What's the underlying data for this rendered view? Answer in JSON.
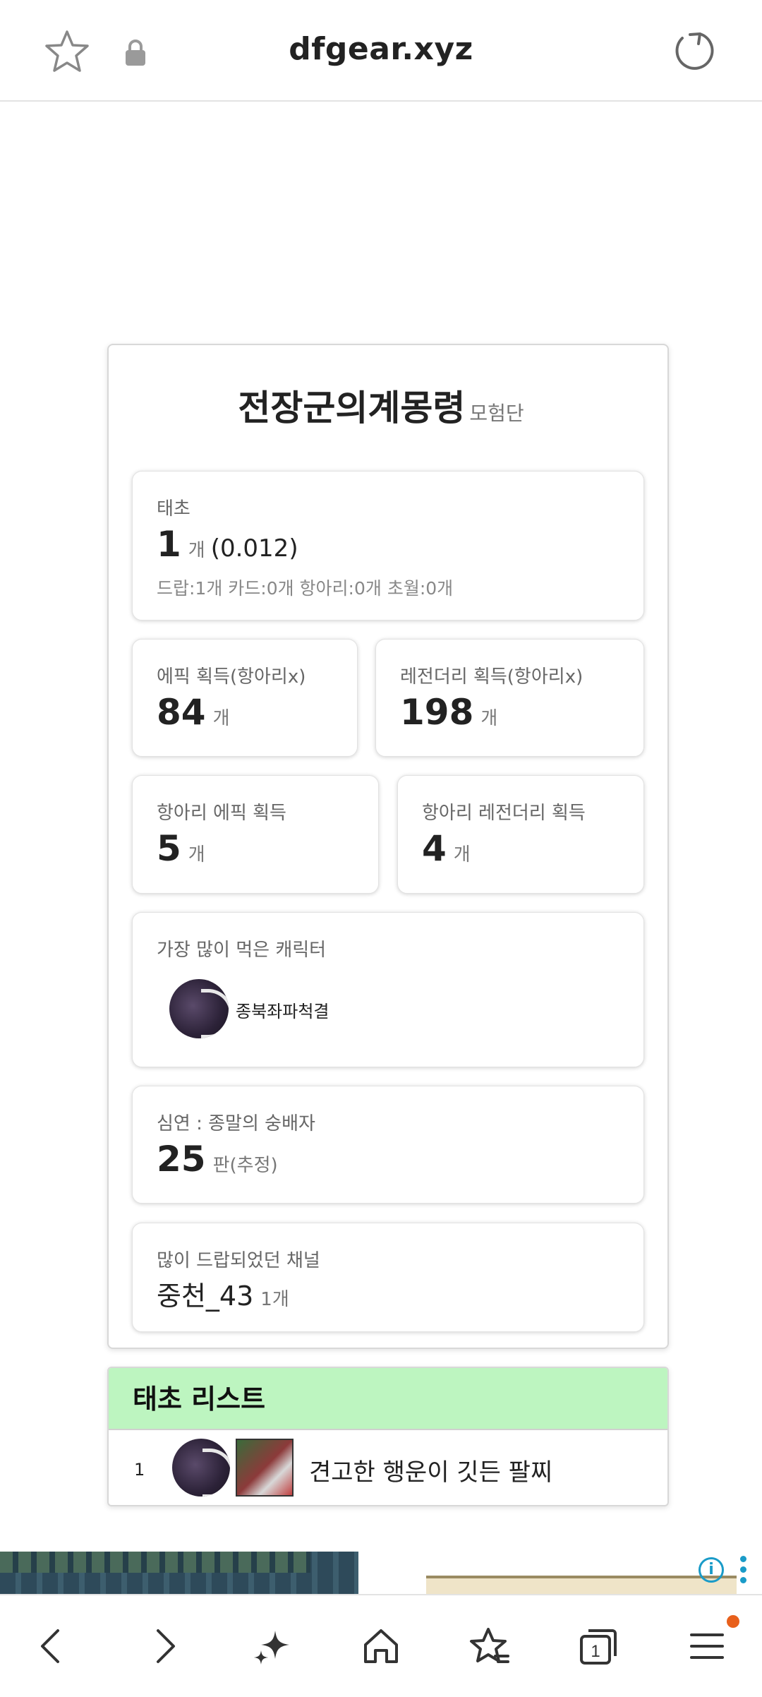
{
  "browser": {
    "url": "dfgear.xyz",
    "tab_count": "1"
  },
  "card": {
    "title": "전장군의계몽령",
    "subtitle": "모험단"
  },
  "taecho": {
    "label": "태초",
    "value": "1",
    "unit": "개",
    "ratio": "(0.012)",
    "detail": "드랍:1개 카드:0개 항아리:0개 초월:0개"
  },
  "epic": {
    "label": "에픽 획득(항아리x)",
    "value": "84",
    "unit": "개"
  },
  "legendary": {
    "label": "레전더리 획득(항아리x)",
    "value": "198",
    "unit": "개"
  },
  "pot_epic": {
    "label": "항아리 에픽 획득",
    "value": "5",
    "unit": "개"
  },
  "pot_legendary": {
    "label": "항아리 레전더리 획득",
    "value": "4",
    "unit": "개"
  },
  "top_character": {
    "label": "가장 많이 먹은 캐릭터",
    "name": "종북좌파척결"
  },
  "abyss": {
    "label": "심연 : 종말의 숭배자",
    "value": "25",
    "unit": "판(추정)"
  },
  "channel": {
    "label": "많이 드랍되었던 채널",
    "value": "중천_43",
    "unit": "1개"
  },
  "taecho_list": {
    "title": "태초 리스트",
    "items": [
      {
        "num": "1",
        "name": "견고한 행운이 깃든 팔찌"
      }
    ]
  }
}
